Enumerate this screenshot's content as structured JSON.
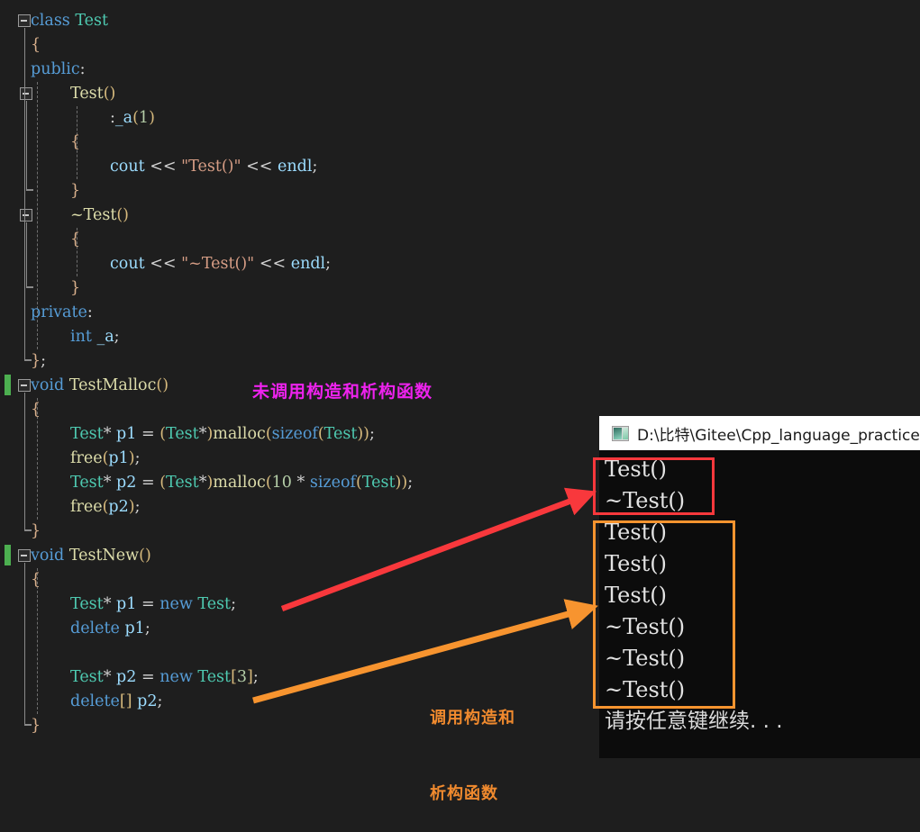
{
  "editor": {
    "background": "#1e1e1e",
    "lines": [
      {
        "indent": 0,
        "tokens": [
          {
            "t": "class ",
            "c": "kw"
          },
          {
            "t": "Test",
            "c": "typ"
          }
        ]
      },
      {
        "indent": 0,
        "tokens": [
          {
            "t": "{",
            "c": "brc"
          }
        ]
      },
      {
        "indent": 0,
        "tokens": [
          {
            "t": "public",
            "c": "kw"
          },
          {
            "t": ":",
            "c": "pun"
          }
        ]
      },
      {
        "indent": 1,
        "tokens": [
          {
            "t": "Test",
            "c": "fn"
          },
          {
            "t": "()",
            "c": "par"
          }
        ]
      },
      {
        "indent": 2,
        "tokens": [
          {
            "t": ":",
            "c": "pun"
          },
          {
            "t": "_a",
            "c": "var"
          },
          {
            "t": "(",
            "c": "par"
          },
          {
            "t": "1",
            "c": "num"
          },
          {
            "t": ")",
            "c": "par"
          }
        ]
      },
      {
        "indent": 1,
        "tokens": [
          {
            "t": "{",
            "c": "brc"
          }
        ]
      },
      {
        "indent": 2,
        "tokens": [
          {
            "t": "cout",
            "c": "var"
          },
          {
            "t": " ",
            "c": "pun"
          },
          {
            "t": "<<",
            "c": "op"
          },
          {
            "t": " ",
            "c": "pun"
          },
          {
            "t": "\"Test()\"",
            "c": "str"
          },
          {
            "t": " ",
            "c": "pun"
          },
          {
            "t": "<<",
            "c": "op"
          },
          {
            "t": " ",
            "c": "pun"
          },
          {
            "t": "endl",
            "c": "var"
          },
          {
            "t": ";",
            "c": "pun"
          }
        ]
      },
      {
        "indent": 1,
        "tokens": [
          {
            "t": "}",
            "c": "brc"
          }
        ]
      },
      {
        "indent": 1,
        "tokens": [
          {
            "t": "~Test",
            "c": "fn"
          },
          {
            "t": "()",
            "c": "par"
          }
        ]
      },
      {
        "indent": 1,
        "tokens": [
          {
            "t": "{",
            "c": "brc"
          }
        ]
      },
      {
        "indent": 2,
        "tokens": [
          {
            "t": "cout",
            "c": "var"
          },
          {
            "t": " ",
            "c": "pun"
          },
          {
            "t": "<<",
            "c": "op"
          },
          {
            "t": " ",
            "c": "pun"
          },
          {
            "t": "\"~Test()\"",
            "c": "str"
          },
          {
            "t": " ",
            "c": "pun"
          },
          {
            "t": "<<",
            "c": "op"
          },
          {
            "t": " ",
            "c": "pun"
          },
          {
            "t": "endl",
            "c": "var"
          },
          {
            "t": ";",
            "c": "pun"
          }
        ]
      },
      {
        "indent": 1,
        "tokens": [
          {
            "t": "}",
            "c": "brc"
          }
        ]
      },
      {
        "indent": 0,
        "tokens": [
          {
            "t": "private",
            "c": "kw"
          },
          {
            "t": ":",
            "c": "pun"
          }
        ]
      },
      {
        "indent": 1,
        "tokens": [
          {
            "t": "int",
            "c": "kw"
          },
          {
            "t": " ",
            "c": "pun"
          },
          {
            "t": "_a",
            "c": "var"
          },
          {
            "t": ";",
            "c": "pun"
          }
        ]
      },
      {
        "indent": 0,
        "tokens": [
          {
            "t": "}",
            "c": "brc"
          },
          {
            "t": ";",
            "c": "pun"
          }
        ]
      },
      {
        "indent": 0,
        "tokens": [
          {
            "t": "void",
            "c": "kw"
          },
          {
            "t": " ",
            "c": "pun"
          },
          {
            "t": "TestMalloc",
            "c": "fn"
          },
          {
            "t": "()",
            "c": "par"
          }
        ]
      },
      {
        "indent": 0,
        "tokens": [
          {
            "t": "{",
            "c": "brc"
          }
        ]
      },
      {
        "indent": 1,
        "tokens": [
          {
            "t": "Test",
            "c": "typ"
          },
          {
            "t": "*",
            "c": "op"
          },
          {
            "t": " ",
            "c": "pun"
          },
          {
            "t": "p1",
            "c": "var"
          },
          {
            "t": " ",
            "c": "pun"
          },
          {
            "t": "=",
            "c": "op"
          },
          {
            "t": " ",
            "c": "pun"
          },
          {
            "t": "(",
            "c": "par"
          },
          {
            "t": "Test",
            "c": "typ"
          },
          {
            "t": "*",
            "c": "op"
          },
          {
            "t": ")",
            "c": "par"
          },
          {
            "t": "malloc",
            "c": "fn"
          },
          {
            "t": "(",
            "c": "par"
          },
          {
            "t": "sizeof",
            "c": "kw"
          },
          {
            "t": "(",
            "c": "par"
          },
          {
            "t": "Test",
            "c": "typ"
          },
          {
            "t": "))",
            "c": "par"
          },
          {
            "t": ";",
            "c": "pun"
          }
        ]
      },
      {
        "indent": 1,
        "tokens": [
          {
            "t": "free",
            "c": "fn"
          },
          {
            "t": "(",
            "c": "par"
          },
          {
            "t": "p1",
            "c": "var"
          },
          {
            "t": ")",
            "c": "par"
          },
          {
            "t": ";",
            "c": "pun"
          }
        ]
      },
      {
        "indent": 1,
        "tokens": [
          {
            "t": "Test",
            "c": "typ"
          },
          {
            "t": "*",
            "c": "op"
          },
          {
            "t": " ",
            "c": "pun"
          },
          {
            "t": "p2",
            "c": "var"
          },
          {
            "t": " ",
            "c": "pun"
          },
          {
            "t": "=",
            "c": "op"
          },
          {
            "t": " ",
            "c": "pun"
          },
          {
            "t": "(",
            "c": "par"
          },
          {
            "t": "Test",
            "c": "typ"
          },
          {
            "t": "*",
            "c": "op"
          },
          {
            "t": ")",
            "c": "par"
          },
          {
            "t": "malloc",
            "c": "fn"
          },
          {
            "t": "(",
            "c": "par"
          },
          {
            "t": "10",
            "c": "num"
          },
          {
            "t": " ",
            "c": "pun"
          },
          {
            "t": "*",
            "c": "op"
          },
          {
            "t": " ",
            "c": "pun"
          },
          {
            "t": "sizeof",
            "c": "kw"
          },
          {
            "t": "(",
            "c": "par"
          },
          {
            "t": "Test",
            "c": "typ"
          },
          {
            "t": "))",
            "c": "par"
          },
          {
            "t": ";",
            "c": "pun"
          }
        ]
      },
      {
        "indent": 1,
        "tokens": [
          {
            "t": "free",
            "c": "fn"
          },
          {
            "t": "(",
            "c": "par"
          },
          {
            "t": "p2",
            "c": "var"
          },
          {
            "t": ")",
            "c": "par"
          },
          {
            "t": ";",
            "c": "pun"
          }
        ]
      },
      {
        "indent": 0,
        "tokens": [
          {
            "t": "}",
            "c": "brc"
          }
        ]
      },
      {
        "indent": 0,
        "tokens": [
          {
            "t": "void",
            "c": "kw"
          },
          {
            "t": " ",
            "c": "pun"
          },
          {
            "t": "TestNew",
            "c": "fn"
          },
          {
            "t": "()",
            "c": "par"
          }
        ]
      },
      {
        "indent": 0,
        "tokens": [
          {
            "t": "{",
            "c": "brc"
          }
        ]
      },
      {
        "indent": 1,
        "tokens": [
          {
            "t": "Test",
            "c": "typ"
          },
          {
            "t": "*",
            "c": "op"
          },
          {
            "t": " ",
            "c": "pun"
          },
          {
            "t": "p1",
            "c": "var"
          },
          {
            "t": " ",
            "c": "pun"
          },
          {
            "t": "=",
            "c": "op"
          },
          {
            "t": " ",
            "c": "pun"
          },
          {
            "t": "new",
            "c": "kw"
          },
          {
            "t": " ",
            "c": "pun"
          },
          {
            "t": "Test",
            "c": "typ"
          },
          {
            "t": ";",
            "c": "pun"
          }
        ]
      },
      {
        "indent": 1,
        "tokens": [
          {
            "t": "delete",
            "c": "kw"
          },
          {
            "t": " ",
            "c": "pun"
          },
          {
            "t": "p1",
            "c": "var"
          },
          {
            "t": ";",
            "c": "pun"
          }
        ]
      },
      {
        "indent": 1,
        "tokens": []
      },
      {
        "indent": 1,
        "tokens": [
          {
            "t": "Test",
            "c": "typ"
          },
          {
            "t": "*",
            "c": "op"
          },
          {
            "t": " ",
            "c": "pun"
          },
          {
            "t": "p2",
            "c": "var"
          },
          {
            "t": " ",
            "c": "pun"
          },
          {
            "t": "=",
            "c": "op"
          },
          {
            "t": " ",
            "c": "pun"
          },
          {
            "t": "new",
            "c": "kw"
          },
          {
            "t": " ",
            "c": "pun"
          },
          {
            "t": "Test",
            "c": "typ"
          },
          {
            "t": "[",
            "c": "par"
          },
          {
            "t": "3",
            "c": "num"
          },
          {
            "t": "]",
            "c": "par"
          },
          {
            "t": ";",
            "c": "pun"
          }
        ]
      },
      {
        "indent": 1,
        "tokens": [
          {
            "t": "delete",
            "c": "kw"
          },
          {
            "t": "[]",
            "c": "par"
          },
          {
            "t": " ",
            "c": "pun"
          },
          {
            "t": "p2",
            "c": "var"
          },
          {
            "t": ";",
            "c": "pun"
          }
        ]
      },
      {
        "indent": 0,
        "tokens": [
          {
            "t": "}",
            "c": "brc"
          }
        ]
      }
    ]
  },
  "annotations": {
    "malloc_note": "未调用构造和析构函数",
    "malloc_note_color": "#ee22ee",
    "new_note_line1": "调用构造和",
    "new_note_line2": "析构函数",
    "new_note_color": "#f08a2e",
    "arrow_red_color": "#f8383c",
    "arrow_orange_color": "#f7942f"
  },
  "console": {
    "title": "D:\\比特\\Gitee\\Cpp_language_practice",
    "icon": "console-window-icon",
    "background": "#0c0c0c",
    "output": [
      "Test()",
      "~Test()",
      "Test()",
      "Test()",
      "Test()",
      "~Test()",
      "~Test()",
      "~Test()"
    ],
    "prompt": "请按任意键继续. . .",
    "highlight_red": {
      "label": "new-single-output-box",
      "color": "#f8383c",
      "lines": [
        "Test()",
        "~Test()"
      ]
    },
    "highlight_orange": {
      "label": "new-array-output-box",
      "color": "#f7942f",
      "lines": [
        "Test()",
        "Test()",
        "Test()",
        "~Test()",
        "~Test()",
        "~Test()"
      ]
    }
  }
}
